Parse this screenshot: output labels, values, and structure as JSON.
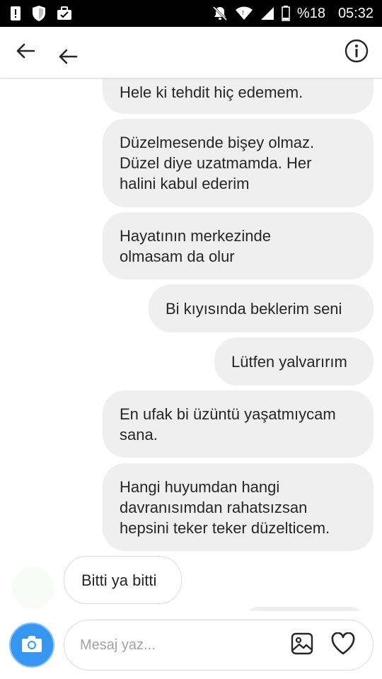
{
  "status_bar": {
    "battery_percent": "%18",
    "time": "05:32",
    "icons": [
      "alert-icon",
      "shield-icon",
      "briefcase-icon",
      "mute-icon",
      "wifi-icon",
      "signal-icon",
      "battery-icon"
    ]
  },
  "header": {
    "icons": [
      "back-arrow-icon",
      "back-arrow-icon",
      "info-icon"
    ]
  },
  "messages": [
    {
      "text": "Hele ki tehdit hiç edemem.",
      "direction": "sent"
    },
    {
      "text": "Düzelmesende bişey olmaz.\nDüzel diye uzatmamda. Her\nhalini kabul ederim",
      "direction": "sent"
    },
    {
      "text": "Hayatının merkezinde\nolmasam da olur",
      "direction": "sent"
    },
    {
      "text": "Bi kıyısında beklerim seni",
      "direction": "sent"
    },
    {
      "text": "Lütfen yalvarırım",
      "direction": "sent"
    },
    {
      "text": "En ufak bi üzüntü yaşatmıycam\nsana.",
      "direction": "sent"
    },
    {
      "text": "Hangi huyumdan hangi\ndavranısımdan rahatsızsan\nhepsini teker teker düzelticem.",
      "direction": "sent"
    },
    {
      "text": "Bitti ya bitti",
      "direction": "received"
    }
  ],
  "composer": {
    "placeholder": "Mesaj yaz...",
    "icons": [
      "camera-icon",
      "gallery-icon",
      "heart-icon"
    ]
  },
  "colors": {
    "sent_bubble": "#efefef",
    "received_bubble_border": "#dbdbdb",
    "camera_button": "#3797f0",
    "text": "#262626"
  }
}
